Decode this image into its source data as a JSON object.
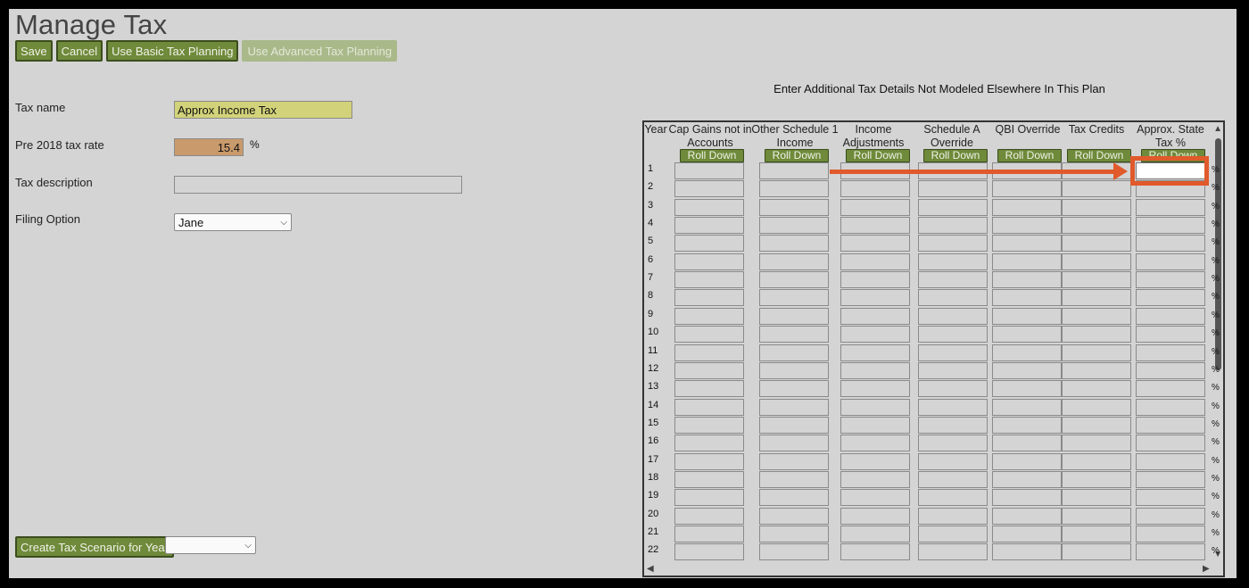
{
  "page": {
    "title": "Manage Tax"
  },
  "toolbar": {
    "save_label": "Save",
    "cancel_label": "Cancel",
    "basic_label": "Use Basic Tax Planning",
    "advanced_label": "Use Advanced Tax Planning"
  },
  "form": {
    "tax_name_label": "Tax name",
    "tax_name_value": "Approx Income Tax",
    "rate_label": "Pre 2018 tax rate",
    "rate_value": "15.4",
    "rate_unit": "%",
    "description_label": "Tax description",
    "description_value": "",
    "filing_label": "Filing Option",
    "filing_value": "Jane"
  },
  "footer": {
    "scenario_label": "Create Tax Scenario for Year",
    "year_value": ""
  },
  "grid": {
    "title": "Enter Additional Tax Details Not Modeled Elsewhere In This Plan",
    "year_header": "Year",
    "roll_label": "Roll Down",
    "pct_symbol": "%",
    "columns": [
      "Cap Gains not in Accounts",
      "Other Schedule 1 Income",
      "Income Adjustments",
      "Schedule A Override",
      "QBI Override",
      "Tax Credits",
      "Approx. State Tax %"
    ],
    "rows": [
      "1",
      "2",
      "3",
      "4",
      "5",
      "6",
      "7",
      "8",
      "9",
      "10",
      "11",
      "12",
      "13",
      "14",
      "15",
      "16",
      "17",
      "18",
      "19",
      "20",
      "21",
      "22"
    ]
  },
  "colors": {
    "button_green": "#6e8a3a",
    "highlight_orange": "#e05a2b",
    "name_field": "#d2d27a",
    "rate_field": "#c99a6c"
  },
  "icons": {
    "dropdown": "chevron-down-icon",
    "scroll_up": "scroll-up-arrow-icon",
    "scroll_down": "scroll-down-arrow-icon",
    "scroll_left": "scroll-left-arrow-icon",
    "scroll_right": "scroll-right-arrow-icon"
  }
}
